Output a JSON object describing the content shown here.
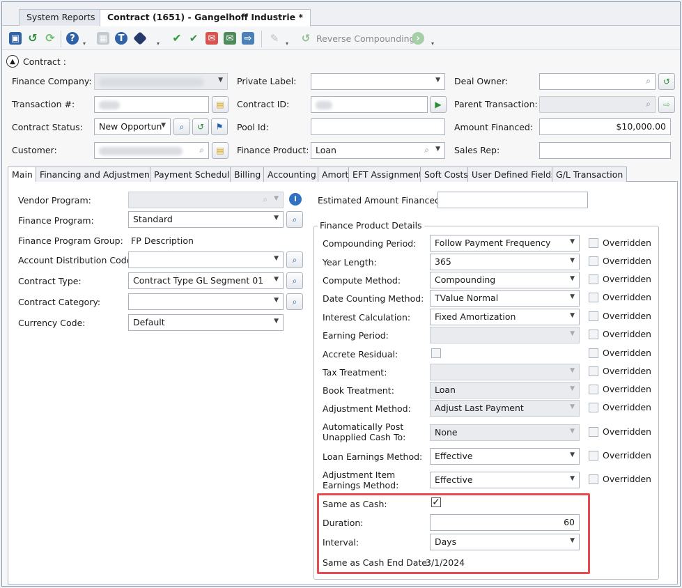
{
  "doc_tabs": [
    {
      "label": "System Reports"
    },
    {
      "label": "Contract (1651) - Gangelhoff Industrie *"
    }
  ],
  "toolbar": {
    "reverse_compounding_label": "Reverse Compounding"
  },
  "section": {
    "title": "Contract :"
  },
  "header_form": {
    "finance_company_label": "Finance Company:",
    "transaction_label": "Transaction #:",
    "contract_status_label": "Contract Status:",
    "contract_status_value": "New Opportun",
    "customer_label": "Customer:",
    "private_label_label": "Private Label:",
    "contract_id_label": "Contract ID:",
    "pool_id_label": "Pool Id:",
    "finance_product_label": "Finance Product:",
    "finance_product_value": "Loan",
    "deal_owner_label": "Deal Owner:",
    "parent_transaction_label": "Parent Transaction:",
    "amount_financed_label": "Amount Financed:",
    "amount_financed_value": "$10,000.00",
    "sales_rep_label": "Sales Rep:"
  },
  "main_tabs": [
    {
      "label": "Main"
    },
    {
      "label": "Financing and Adjustments"
    },
    {
      "label": "Payment Schedule"
    },
    {
      "label": "Billing"
    },
    {
      "label": "Accounting"
    },
    {
      "label": "Amort"
    },
    {
      "label": "EFT Assignment"
    },
    {
      "label": "Soft Costs"
    },
    {
      "label": "User Defined Fields"
    },
    {
      "label": "G/L Transaction"
    }
  ],
  "left_form": {
    "vendor_program_label": "Vendor Program:",
    "finance_program_label": "Finance Program:",
    "finance_program_value": "Standard",
    "finance_program_group_label": "Finance Program Group:",
    "finance_program_group_value": "FP Description",
    "account_distribution_label": "Account Distribution Code:",
    "contract_type_label": "Contract Type:",
    "contract_type_value": "Contract Type GL Segment 01",
    "contract_category_label": "Contract Category:",
    "currency_code_label": "Currency Code:",
    "currency_code_value": "Default"
  },
  "estimated_amount_label": "Estimated Amount Financed:",
  "fpd": {
    "title": "Finance Product Details",
    "overridden_label": "Overridden",
    "compounding_period_label": "Compounding Period:",
    "compounding_period_value": "Follow Payment Frequency",
    "year_length_label": "Year Length:",
    "year_length_value": "365",
    "compute_method_label": "Compute Method:",
    "compute_method_value": "Compounding",
    "date_counting_label": "Date Counting Method:",
    "date_counting_value": "TValue Normal",
    "interest_calc_label": "Interest Calculation:",
    "interest_calc_value": "Fixed Amortization",
    "earning_period_label": "Earning Period:",
    "accrete_residual_label": "Accrete Residual:",
    "tax_treatment_label": "Tax Treatment:",
    "book_treatment_label": "Book Treatment:",
    "book_treatment_value": "Loan",
    "adjustment_method_label": "Adjustment Method:",
    "adjustment_method_value": "Adjust Last Payment",
    "auto_post_label_1": "Automatically Post",
    "auto_post_label_2": "Unapplied Cash To:",
    "auto_post_value": "None",
    "loan_earnings_label": "Loan Earnings Method:",
    "loan_earnings_value": "Effective",
    "adj_item_label_1": "Adjustment Item",
    "adj_item_label_2": "Earnings Method:",
    "adj_item_value": "Effective",
    "same_as_cash_label": "Same as Cash:",
    "same_as_cash_checked": true,
    "duration_label": "Duration:",
    "duration_value": "60",
    "interval_label": "Interval:",
    "interval_value": "Days",
    "end_date_label": "Same as Cash End Date:",
    "end_date_value": "3/1/2024"
  }
}
